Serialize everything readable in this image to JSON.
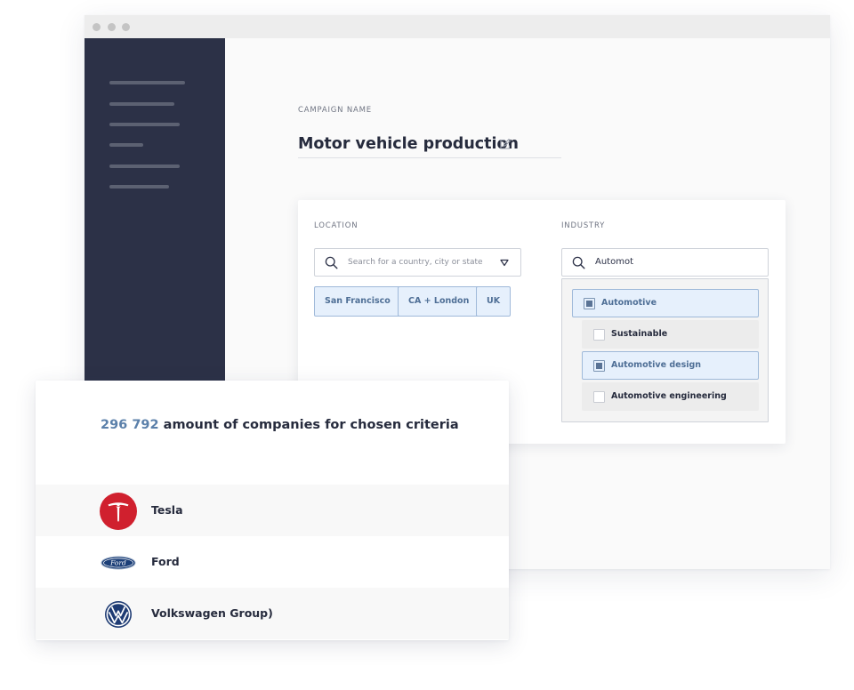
{
  "campaign": {
    "label": "CAMPAIGN NAME",
    "name": "Motor vehicle production"
  },
  "location": {
    "label": "LOCATION",
    "placeholder": "Search for a country, city or state",
    "chips": [
      "San Francisco",
      "CA + London",
      "UK"
    ]
  },
  "industry": {
    "label": "INDUSTRY",
    "query": "Automot",
    "options": [
      {
        "label": "Automotive",
        "checked": true
      },
      {
        "label": "Sustainable",
        "checked": false
      },
      {
        "label": "Automotive design",
        "checked": true
      },
      {
        "label": "Automotive engineering",
        "checked": false
      }
    ]
  },
  "results": {
    "count": "296 792",
    "text": "amount of companies for chosen criteria",
    "companies": [
      {
        "name": "Tesla",
        "logo": "tesla-logo"
      },
      {
        "name": "Ford",
        "logo": "ford-logo"
      },
      {
        "name": "Volkswagen Group)",
        "logo": "volkswagen-logo"
      }
    ]
  },
  "colors": {
    "sidebar": "#2c3147",
    "accent": "#5b80aa",
    "chip_bg": "#e6f0fc",
    "chip_border": "#9fb9d9",
    "tesla_red": "#d0202e",
    "ford_blue": "#1c3f78",
    "vw_blue": "#1e3b73"
  }
}
